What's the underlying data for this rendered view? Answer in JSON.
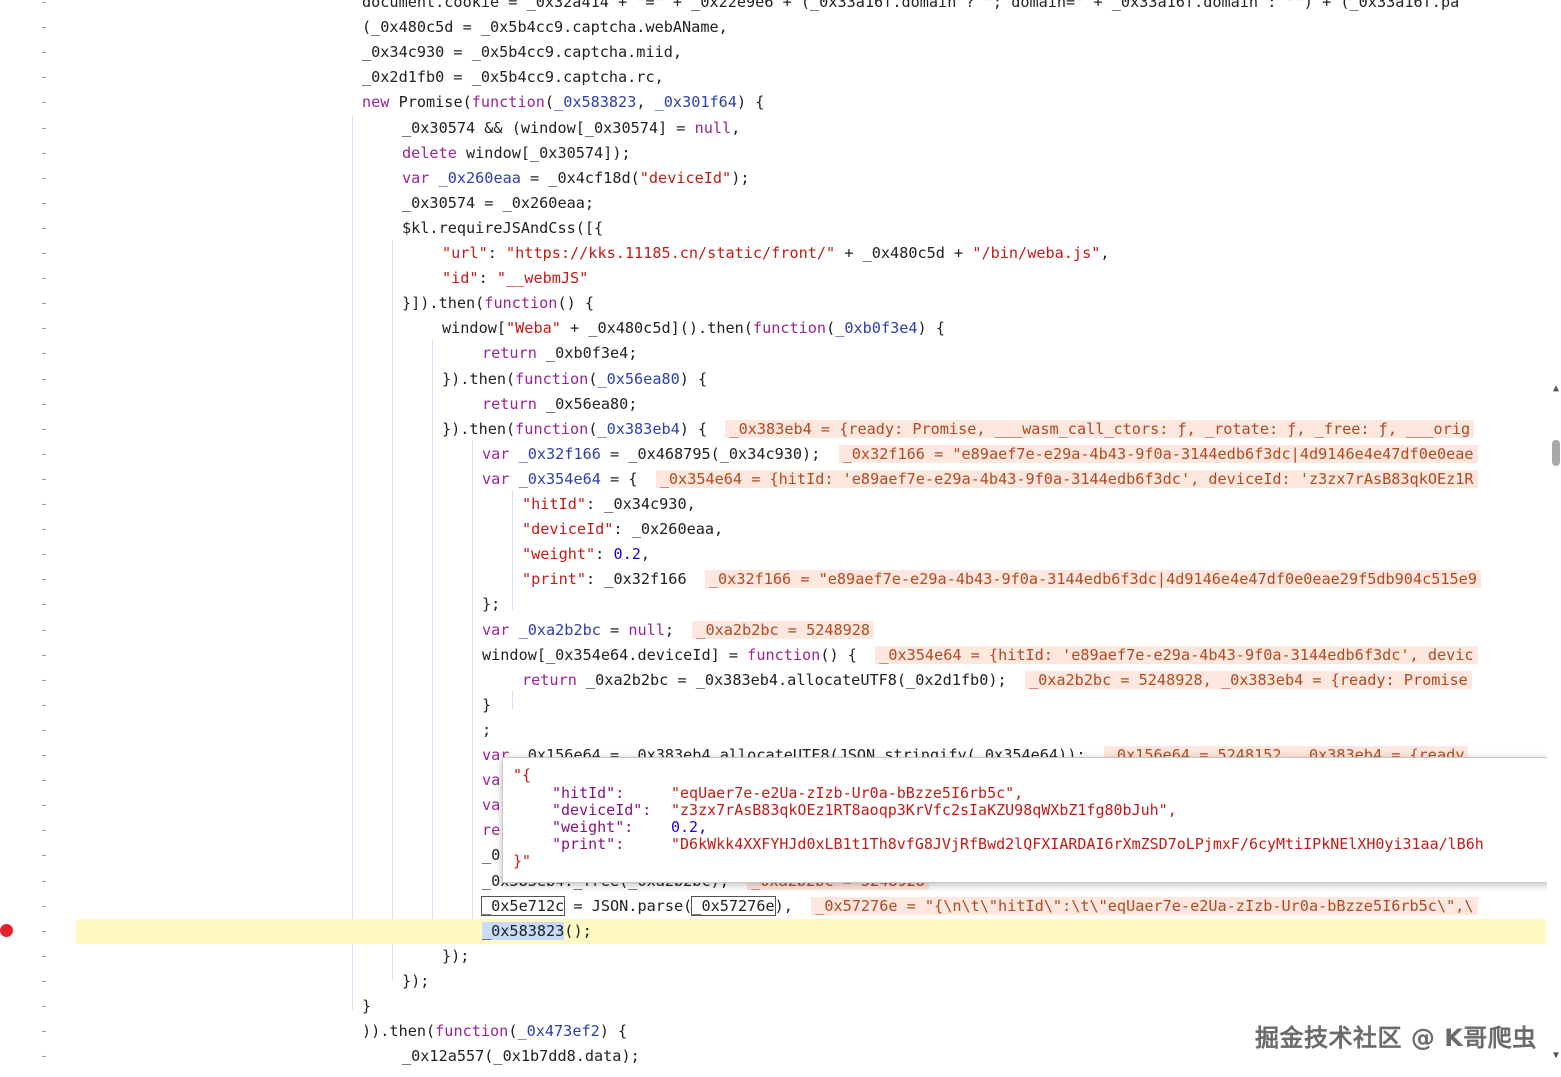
{
  "gutter_marker": "-",
  "code_lines": [
    {
      "segments": [
        {
          "t": "document.cookie = _0x32a414 + \"=\" + _0x22e9e6 + (_0x33a16f.domain ? \"; domain=\" + _0x33a16f.domain : \"\") + (_0x33a16f.pa"
        }
      ]
    },
    {
      "segments": [
        {
          "t": "(_0x480c5d = _0x5b4cc9.captcha.webAName,"
        }
      ]
    },
    {
      "segments": [
        {
          "t": "_0x34c930 = _0x5b4cc9.captcha.miid,"
        }
      ]
    },
    {
      "segments": [
        {
          "t": "_0x2d1fb0 = _0x5b4cc9.captcha.rc,"
        }
      ]
    },
    {
      "segments": [
        {
          "t": "new",
          "c": "kw"
        },
        {
          "t": " Promise("
        },
        {
          "t": "function",
          "c": "kw"
        },
        {
          "t": "("
        },
        {
          "t": "_0x583823",
          "c": "pn"
        },
        {
          "t": ", "
        },
        {
          "t": "_0x301f64",
          "c": "pn"
        },
        {
          "t": ") {"
        }
      ]
    },
    {
      "segments": [
        {
          "t": "_0x30574 && (window[_0x30574] = "
        },
        {
          "t": "null",
          "c": "kw"
        },
        {
          "t": ","
        }
      ]
    },
    {
      "segments": [
        {
          "t": "delete",
          "c": "kw"
        },
        {
          "t": " window[_0x30574]);"
        }
      ]
    },
    {
      "segments": [
        {
          "t": "var",
          "c": "kw"
        },
        {
          "t": " "
        },
        {
          "t": "_0x260eaa",
          "c": "pn"
        },
        {
          "t": " = _0x4cf18d("
        },
        {
          "t": "\"deviceId\"",
          "c": "s"
        },
        {
          "t": ");"
        }
      ]
    },
    {
      "segments": [
        {
          "t": "_0x30574 = _0x260eaa;"
        }
      ]
    },
    {
      "segments": [
        {
          "t": "$kl.requireJSAndCss([{"
        }
      ]
    },
    {
      "segments": [
        {
          "t": "\"url\"",
          "c": "s"
        },
        {
          "t": ": "
        },
        {
          "t": "\"https://kks.11185.cn/static/front/\"",
          "c": "s"
        },
        {
          "t": " + _0x480c5d + "
        },
        {
          "t": "\"/bin/weba.js\"",
          "c": "s"
        },
        {
          "t": ","
        }
      ]
    },
    {
      "segments": [
        {
          "t": "\"id\"",
          "c": "s"
        },
        {
          "t": ": "
        },
        {
          "t": "\"__webmJS\"",
          "c": "s"
        }
      ]
    },
    {
      "segments": [
        {
          "t": "}]).then("
        },
        {
          "t": "function",
          "c": "kw"
        },
        {
          "t": "() {"
        }
      ]
    },
    {
      "segments": [
        {
          "t": "window["
        },
        {
          "t": "\"Weba\"",
          "c": "s"
        },
        {
          "t": " + _0x480c5d]().then("
        },
        {
          "t": "function",
          "c": "kw"
        },
        {
          "t": "("
        },
        {
          "t": "_0xb0f3e4",
          "c": "pn"
        },
        {
          "t": ") {"
        }
      ]
    },
    {
      "segments": [
        {
          "t": "return",
          "c": "kw"
        },
        {
          "t": " _0xb0f3e4;"
        }
      ]
    },
    {
      "segments": [
        {
          "t": "}).then("
        },
        {
          "t": "function",
          "c": "kw"
        },
        {
          "t": "("
        },
        {
          "t": "_0x56ea80",
          "c": "pn"
        },
        {
          "t": ") {"
        }
      ]
    },
    {
      "segments": [
        {
          "t": "return",
          "c": "kw"
        },
        {
          "t": " _0x56ea80;"
        }
      ]
    },
    {
      "segments": [
        {
          "t": "}).then("
        },
        {
          "t": "function",
          "c": "kw"
        },
        {
          "t": "("
        },
        {
          "t": "_0x383eb4",
          "c": "pn"
        },
        {
          "t": ") {  "
        },
        {
          "t": "_0x383eb4 = {ready: Promise, ___wasm_call_ctors: ƒ, _rotate: ƒ, _free: ƒ, ___orig",
          "c": "inl"
        }
      ]
    },
    {
      "segments": [
        {
          "t": "var",
          "c": "kw"
        },
        {
          "t": " "
        },
        {
          "t": "_0x32f166",
          "c": "pn"
        },
        {
          "t": " = _0x468795(_0x34c930);  "
        },
        {
          "t": "_0x32f166 = \"e89aef7e-e29a-4b43-9f0a-3144edb6f3dc|4d9146e4e47df0e0eae",
          "c": "inl"
        }
      ]
    },
    {
      "segments": [
        {
          "t": "var",
          "c": "kw"
        },
        {
          "t": " "
        },
        {
          "t": "_0x354e64",
          "c": "pn"
        },
        {
          "t": " = {  "
        },
        {
          "t": "_0x354e64 = {hitId: 'e89aef7e-e29a-4b43-9f0a-3144edb6f3dc', deviceId: 'z3zx7rAsB83qkOEz1R",
          "c": "inl"
        }
      ]
    },
    {
      "segments": [
        {
          "t": "\"hitId\"",
          "c": "s"
        },
        {
          "t": ": _0x34c930,"
        }
      ]
    },
    {
      "segments": [
        {
          "t": "\"deviceId\"",
          "c": "s"
        },
        {
          "t": ": _0x260eaa,"
        }
      ]
    },
    {
      "segments": [
        {
          "t": "\"weight\"",
          "c": "s"
        },
        {
          "t": ": "
        },
        {
          "t": "0.2",
          "c": "n"
        },
        {
          "t": ","
        }
      ]
    },
    {
      "segments": [
        {
          "t": "\"print\"",
          "c": "s"
        },
        {
          "t": ": _0x32f166  "
        },
        {
          "t": "_0x32f166 = \"e89aef7e-e29a-4b43-9f0a-3144edb6f3dc|4d9146e4e47df0e0eae29f5db904c515e9",
          "c": "inl"
        }
      ]
    },
    {
      "segments": [
        {
          "t": "};"
        }
      ]
    },
    {
      "segments": [
        {
          "t": "var",
          "c": "kw"
        },
        {
          "t": " "
        },
        {
          "t": "_0xa2b2bc",
          "c": "pn"
        },
        {
          "t": " = "
        },
        {
          "t": "null",
          "c": "kw"
        },
        {
          "t": ";  "
        },
        {
          "t": "_0xa2b2bc = 5248928",
          "c": "inl"
        }
      ]
    },
    {
      "segments": [
        {
          "t": "window[_0x354e64.deviceId] = "
        },
        {
          "t": "function",
          "c": "kw"
        },
        {
          "t": "() {  "
        },
        {
          "t": "_0x354e64 = {hitId: 'e89aef7e-e29a-4b43-9f0a-3144edb6f3dc', devic",
          "c": "inl"
        }
      ]
    },
    {
      "segments": [
        {
          "t": "return",
          "c": "kw"
        },
        {
          "t": " _0xa2b2bc = _0x383eb4.allocateUTF8(_0x2d1fb0);  "
        },
        {
          "t": "_0xa2b2bc = 5248928, _0x383eb4 = {ready: Promise",
          "c": "inl"
        }
      ]
    },
    {
      "segments": [
        {
          "t": "}"
        }
      ]
    },
    {
      "segments": [
        {
          "t": ";"
        }
      ]
    },
    {
      "segments": [
        {
          "t": "var",
          "c": "kw"
        },
        {
          "t": " _0x156e64 = _0x383eb4.allocateUTF8(JSON.stringify(_0x354e64));  "
        },
        {
          "t": "_0x156e64 = 5248152, _0x383eb4 = {ready",
          "c": "inl"
        }
      ]
    },
    {
      "segments": [
        {
          "t": "va",
          "c": "kw"
        }
      ]
    },
    {
      "segments": [
        {
          "t": "va",
          "c": "kw"
        }
      ]
    },
    {
      "segments": [
        {
          "t": "re",
          "c": "kw"
        }
      ]
    },
    {
      "segments": [
        {
          "t": "_0"
        }
      ]
    },
    {
      "segments": [
        {
          "t": "_0x383eb4._free(_0xa2b2bc),  "
        },
        {
          "t": "_0xa2b2bc = 5248928",
          "c": "inl"
        }
      ]
    },
    {
      "segments": [
        {
          "t": "_0x5e712c",
          "c": "box"
        },
        {
          "t": " = JSON.parse("
        },
        {
          "t": "_0x57276e",
          "c": "box"
        },
        {
          "t": "),  "
        },
        {
          "t": "_0x57276e = \"{\\n\\t\\\"hitId\\\":\\t\\\"eqUaer7e-e2Ua-zIzb-Ur0a-bBzze5I6rb5c\\\",\\",
          "c": "inl"
        }
      ]
    },
    {
      "segments": [
        {
          "t": "_0x583823",
          "c": "sel"
        },
        {
          "t": "();"
        }
      ]
    },
    {
      "segments": [
        {
          "t": "});"
        }
      ]
    },
    {
      "segments": [
        {
          "t": "});"
        }
      ]
    },
    {
      "segments": [
        {
          "t": "}"
        }
      ]
    },
    {
      "segments": [
        {
          "t": ")).then("
        },
        {
          "t": "function",
          "c": "kw"
        },
        {
          "t": "("
        },
        {
          "t": "_0x473ef2",
          "c": "pn"
        },
        {
          "t": ") {"
        }
      ]
    },
    {
      "segments": [
        {
          "t": "_0x12a557(_0x1b7dd8.data);"
        }
      ]
    }
  ],
  "popover": {
    "open": "\"{",
    "rows": [
      {
        "key": "\"hitId\":",
        "value": "\"eqUaer7e-e2Ua-zIzb-Ur0a-bBzze5I6rb5c\","
      },
      {
        "key": "\"deviceId\":",
        "value": "\"z3zx7rAsB83qkOEz1RT8aoqp3KrVfc2sIaKZU98qWXbZ1fg80bJuh\","
      },
      {
        "key": "\"weight\":",
        "value": "0.2,"
      },
      {
        "key": "\"print\":",
        "value": "\"D6kWkk4XXFYHJd0xLB1t1Th8vfG8JVjRfBwd2lQFXIARDAI6rXmZSD7oLPjmxF/6cyMtiIPkNElXH0yi31aa/lB6h"
      }
    ],
    "close": "}\""
  },
  "watermark": "掘金技术社区 @ K哥爬虫",
  "scroll_up": "▲",
  "scroll_down": "▼",
  "colors": {
    "keyword": "#9b2393",
    "string": "#c41a16",
    "number": "#1c00cf",
    "param": "#2b3fae",
    "inline_bg": "#fde7de",
    "highlight": "#fff9c4",
    "breakpoint": "#e8202a"
  }
}
